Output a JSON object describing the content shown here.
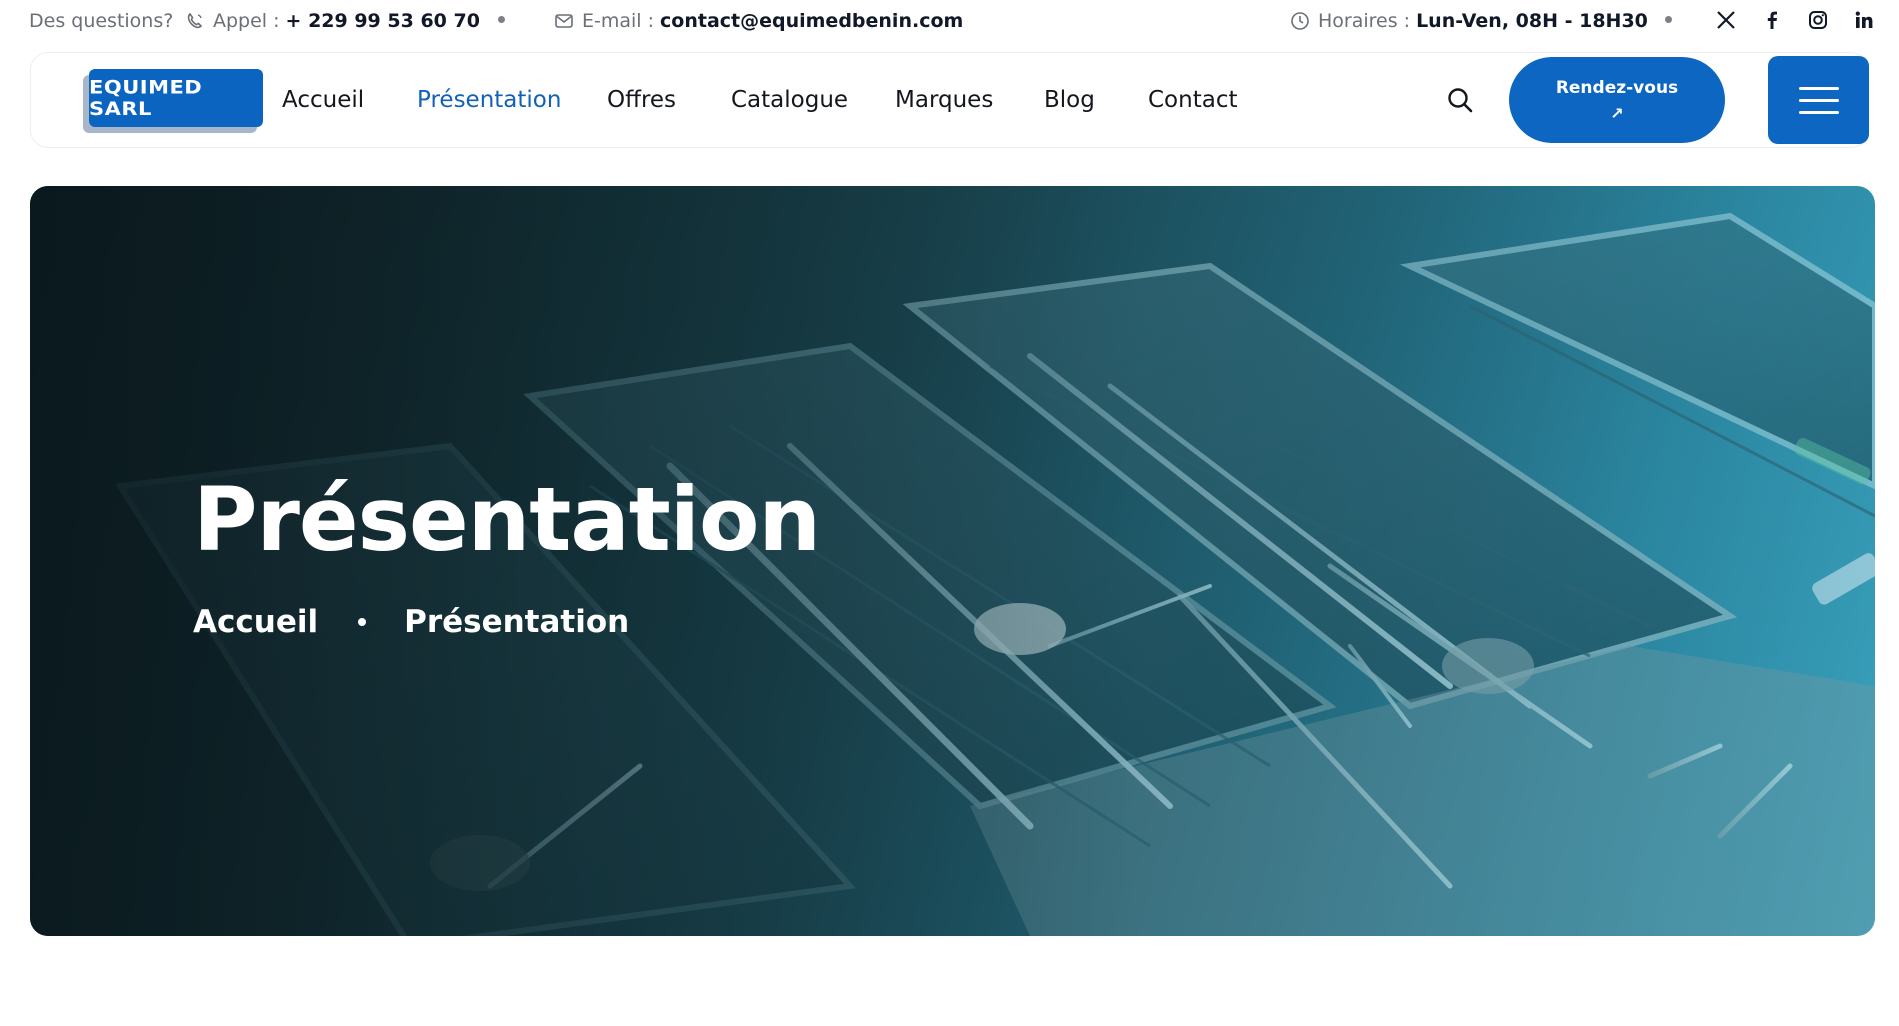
{
  "topbar": {
    "question": "Des questions?",
    "phone_label": "Appel :",
    "phone_value": "+ 229 99 53 60 70",
    "email_label": "E-mail :",
    "email_value": "contact@equimedbenin.com",
    "hours_label": "Horaires :",
    "hours_value": "Lun-Ven, 08H - 18H30",
    "icons": [
      "phone-icon",
      "mail-icon",
      "clock-icon"
    ],
    "socials": [
      "x-icon",
      "facebook-icon",
      "instagram-icon",
      "linkedin-icon"
    ]
  },
  "navbar": {
    "logo_text": "EQUIMED SARL",
    "items": [
      {
        "label": "Accueil"
      },
      {
        "label": "Présentation"
      },
      {
        "label": "Offres"
      },
      {
        "label": "Catalogue"
      },
      {
        "label": "Marques"
      },
      {
        "label": "Blog"
      },
      {
        "label": "Contact"
      }
    ],
    "active_item": "Présentation",
    "cta_label": "Rendez-vous",
    "cta_icon": "arrow-up-right-icon",
    "search_icon": "search-icon",
    "menu_icon": "hamburger-icon"
  },
  "hero": {
    "title": "Présentation",
    "breadcrumb": [
      "Accueil",
      "Présentation"
    ]
  },
  "colors": {
    "accent": "#0c66c2",
    "active_nav": "#1261b8",
    "text": "#111827",
    "muted": "#6b6f77"
  }
}
